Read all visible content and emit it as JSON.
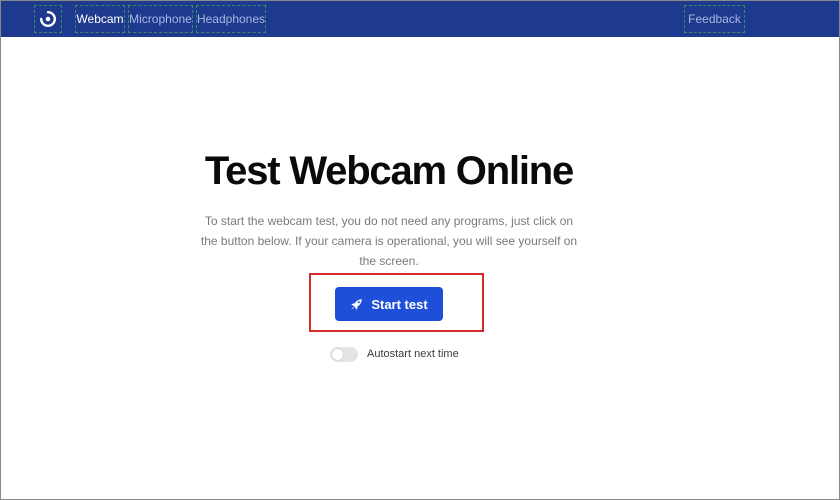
{
  "nav": {
    "logo_icon": "target-icon",
    "links": [
      {
        "label": "Webcam",
        "active": true
      },
      {
        "label": "Microphone",
        "active": false
      },
      {
        "label": "Headphones",
        "active": false
      }
    ],
    "feedback_label": "Feedback"
  },
  "hero": {
    "title": "Test Webcam Online",
    "description": "To start the webcam test, you do not need any programs, just click on the button below. If your camera is operational, you will see yourself on the screen."
  },
  "start_button": {
    "label": "Start test",
    "icon": "rocket-icon"
  },
  "autostart": {
    "label": "Autostart next time",
    "enabled": false
  },
  "colors": {
    "nav_bg": "#1e3a8f",
    "primary": "#1f4ed8",
    "highlight": "#d42a2a"
  }
}
